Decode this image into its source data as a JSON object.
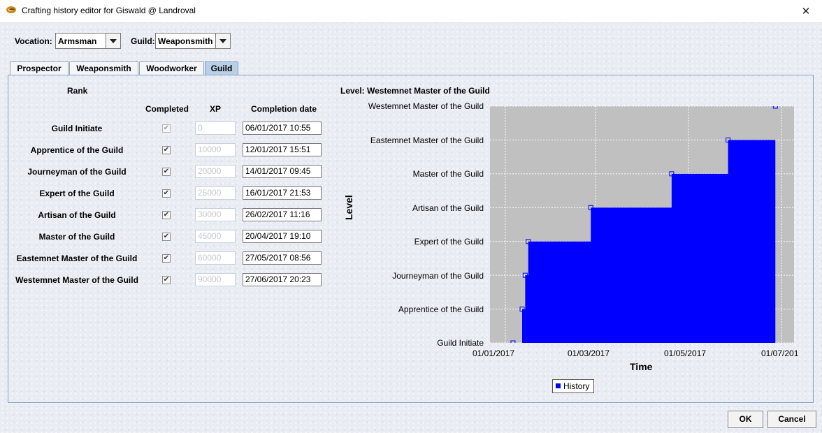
{
  "window": {
    "title": "Crafting history editor for Giswald @ Landroval",
    "close_glyph": "✕"
  },
  "vocation": {
    "label": "Vocation:",
    "value": "Armsman"
  },
  "guild": {
    "label": "Guild:",
    "value": "Weaponsmith"
  },
  "tabs": [
    {
      "label": "Prospector",
      "active": false
    },
    {
      "label": "Weaponsmith",
      "active": false
    },
    {
      "label": "Woodworker",
      "active": false
    },
    {
      "label": "Guild",
      "active": true
    }
  ],
  "table": {
    "headers": {
      "rank": "Rank",
      "completed": "Completed",
      "xp": "XP",
      "date": "Completion date"
    },
    "rows": [
      {
        "rank": "Guild Initiate",
        "completed": true,
        "enabled": false,
        "xp": "0",
        "date": "06/01/2017 10:55"
      },
      {
        "rank": "Apprentice of the Guild",
        "completed": true,
        "enabled": true,
        "xp": "10000",
        "date": "12/01/2017 15:51"
      },
      {
        "rank": "Journeyman of the Guild",
        "completed": true,
        "enabled": true,
        "xp": "20000",
        "date": "14/01/2017 09:45"
      },
      {
        "rank": "Expert of the Guild",
        "completed": true,
        "enabled": true,
        "xp": "25000",
        "date": "16/01/2017 21:53"
      },
      {
        "rank": "Artisan of the Guild",
        "completed": true,
        "enabled": true,
        "xp": "30000",
        "date": "26/02/2017 11:16"
      },
      {
        "rank": "Master of the Guild",
        "completed": true,
        "enabled": true,
        "xp": "45000",
        "date": "20/04/2017 19:10"
      },
      {
        "rank": "Eastemnet Master of the Guild",
        "completed": true,
        "enabled": true,
        "xp": "60000",
        "date": "27/05/2017 08:56"
      },
      {
        "rank": "Westemnet Master of the Guild",
        "completed": true,
        "enabled": true,
        "xp": "90000",
        "date": "27/06/2017 20:23"
      }
    ]
  },
  "chart_data": {
    "type": "area",
    "title": "Level: Westemnet Master of the Guild",
    "xlabel": "Time",
    "ylabel": "Level",
    "x_tick_labels": [
      "01/01/2017",
      "01/03/2017",
      "01/05/2017",
      "01/07/201"
    ],
    "y_tick_labels": [
      "Guild Initiate",
      "Apprentice of the Guild",
      "Journeyman of the Guild",
      "Expert of the Guild",
      "Artisan of the Guild",
      "Master of the Guild",
      "Eastemnet Master of the Guild",
      "Westemnet Master of the Guild"
    ],
    "xlim": [
      "2017-01-01",
      "2017-07-01"
    ],
    "ylim": [
      0,
      7
    ],
    "grid": true,
    "legend_position": "bottom",
    "series": [
      {
        "name": "History",
        "color": "#0000ff",
        "points": [
          {
            "x": "2017-01-06",
            "y": 0
          },
          {
            "x": "2017-01-12",
            "y": 1
          },
          {
            "x": "2017-01-14",
            "y": 2
          },
          {
            "x": "2017-01-16",
            "y": 3
          },
          {
            "x": "2017-02-26",
            "y": 4
          },
          {
            "x": "2017-04-20",
            "y": 5
          },
          {
            "x": "2017-05-27",
            "y": 6
          },
          {
            "x": "2017-06-27",
            "y": 7
          }
        ]
      }
    ]
  },
  "buttons": {
    "ok": "OK",
    "cancel": "Cancel"
  },
  "colors": {
    "tab_active": "#b9cfe6",
    "plot_bg": "#c0c0c0",
    "series": "#0000ff"
  }
}
